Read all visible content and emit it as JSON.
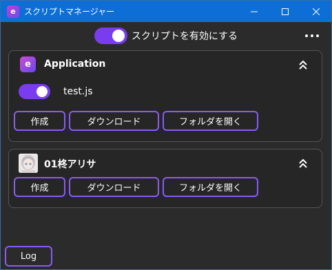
{
  "window": {
    "title": "スクリプトマネージャー",
    "app_icon_glyph": "e",
    "minimize_glyph": "—",
    "maximize_glyph": "☐",
    "close_glyph": "✕"
  },
  "global_toggle": {
    "label": "スクリプトを有効にする",
    "enabled": true
  },
  "menu": {
    "icon": "more-horizontal-icon"
  },
  "cards": [
    {
      "title": "Application",
      "icon": "app-icon",
      "icon_glyph": "e",
      "expanded": true,
      "scripts": [
        {
          "name": "test.js",
          "enabled": true
        }
      ],
      "buttons": {
        "create": "作成",
        "download": "ダウンロード",
        "open_folder": "フォルダを開く"
      }
    },
    {
      "title": "01柊アリサ",
      "icon": "avatar-image",
      "expanded": true,
      "buttons": {
        "create": "作成",
        "download": "ダウンロード",
        "open_folder": "フォルダを開く"
      }
    }
  ],
  "footer": {
    "log_label": "Log"
  },
  "colors": {
    "titlebar": "#0d6fd6",
    "accent": "#7a3cf0",
    "button_border": "#8a5cf5",
    "background": "#2b2b2b",
    "card_border": "#555555"
  }
}
